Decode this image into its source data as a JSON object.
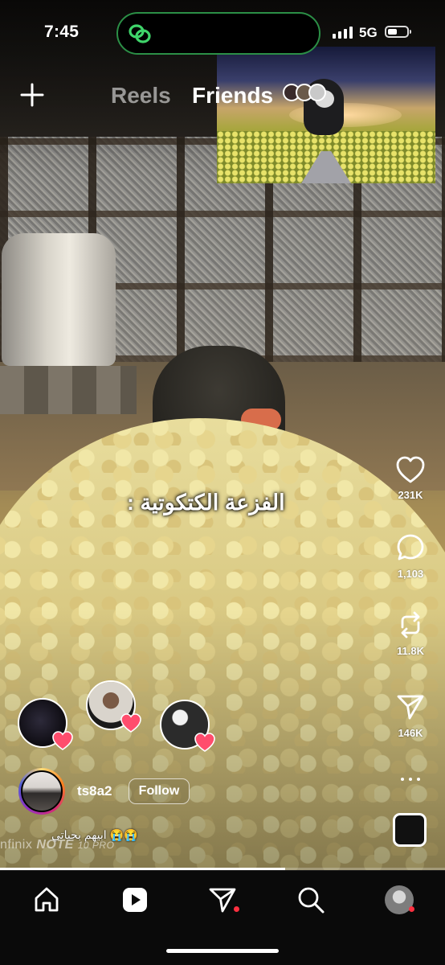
{
  "status_bar": {
    "time": "7:45",
    "network": "5G"
  },
  "header": {
    "tabs": [
      {
        "label": "Reels",
        "active": false
      },
      {
        "label": "Friends",
        "active": true
      }
    ]
  },
  "video": {
    "overlay_text": "الفزعة الكتكوتية :",
    "progress": 0.64
  },
  "actions": {
    "likes": "231K",
    "comments": "1,103",
    "reposts": "11.8K",
    "shares": "146K"
  },
  "post": {
    "username": "ts8a2",
    "follow_label": "Follow",
    "caption": "ابيهم بحياتي 😭😭"
  },
  "watermark": {
    "brand": "nfinix",
    "model": "NOTE",
    "suffix": "10 PRO"
  },
  "colors": {
    "accent": "#ff3040",
    "island_border": "#2b8f46",
    "like_heart": "#ff4d6d"
  },
  "nav": {
    "items": [
      "home-icon",
      "reels-icon",
      "direct-icon",
      "search-icon",
      "profile-avatar"
    ]
  }
}
